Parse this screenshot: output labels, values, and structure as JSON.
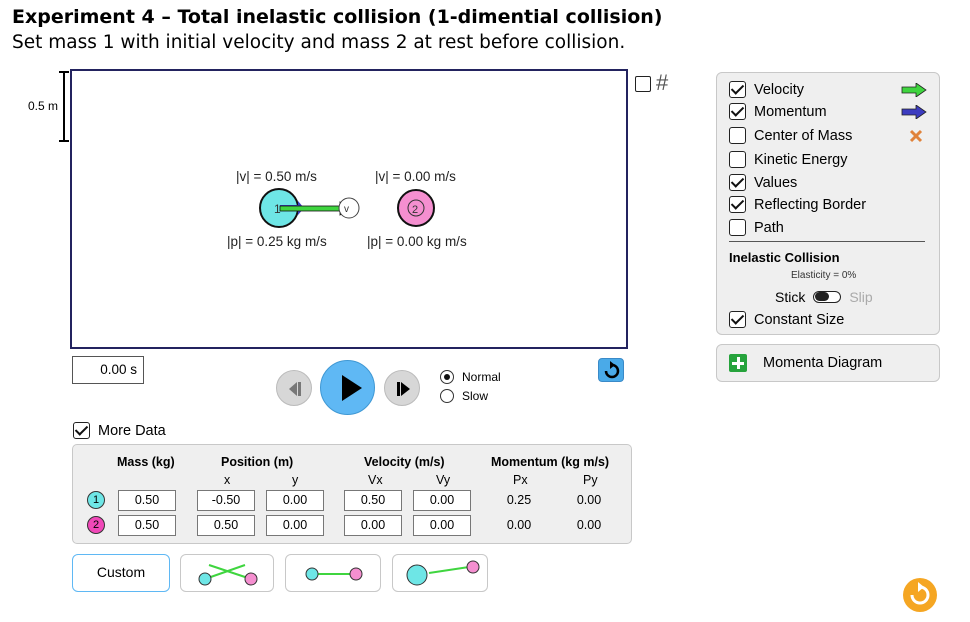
{
  "heading": {
    "title": "Experiment 4 – Total inelastic collision (1-dimential collision)",
    "subtitle": "Set mass 1 with initial velocity and mass 2 at rest before collision."
  },
  "scale": {
    "label": "0.5 m"
  },
  "balls": [
    {
      "id": "1",
      "velocity_text": "|v| = 0.50 m/s",
      "momentum_text": "|p| = 0.25 kg m/s",
      "color": "#6ee6e6"
    },
    {
      "id": "2",
      "velocity_text": "|v| = 0.00 m/s",
      "momentum_text": "|p| = 0.00 kg m/s",
      "color": "#f58fd0"
    }
  ],
  "panel": {
    "options": [
      {
        "label": "Velocity",
        "checked": true,
        "icon": "green-arrow-icon"
      },
      {
        "label": "Momentum",
        "checked": true,
        "icon": "blue-arrow-icon"
      },
      {
        "label": "Center of Mass",
        "checked": false,
        "icon": "orange-x-icon"
      },
      {
        "label": "Kinetic Energy",
        "checked": false
      },
      {
        "label": "Values",
        "checked": true
      },
      {
        "label": "Reflecting Border",
        "checked": true
      },
      {
        "label": "Path",
        "checked": false
      }
    ],
    "collision_title": "Inelastic Collision",
    "elasticity": "Elasticity = 0%",
    "stick_label": "Stick",
    "slip_label": "Slip",
    "constant_size_label": "Constant Size",
    "constant_size_checked": true
  },
  "momenta_diagram_label": "Momenta Diagram",
  "time": {
    "value": "0.00 s"
  },
  "speed": {
    "normal": "Normal",
    "slow": "Slow",
    "selected": "Normal"
  },
  "more_data": {
    "label": "More Data",
    "checked": true
  },
  "table": {
    "headers": {
      "mass": "Mass (kg)",
      "position": "Position (m)",
      "velocity": "Velocity (m/s)",
      "momentum": "Momentum (kg m/s)"
    },
    "sub": {
      "x": "x",
      "y": "y",
      "vx": "Vx",
      "vy": "Vy",
      "px": "Px",
      "py": "Py"
    },
    "rows": [
      {
        "ball": "1",
        "mass": "0.50",
        "x": "-0.50",
        "y": "0.00",
        "vx": "0.50",
        "vy": "0.00",
        "px": "0.25",
        "py": "0.00"
      },
      {
        "ball": "2",
        "mass": "0.50",
        "x": "0.50",
        "y": "0.00",
        "vx": "0.00",
        "vy": "0.00",
        "px": "0.00",
        "py": "0.00"
      }
    ]
  },
  "bottom": {
    "custom_label": "Custom"
  }
}
